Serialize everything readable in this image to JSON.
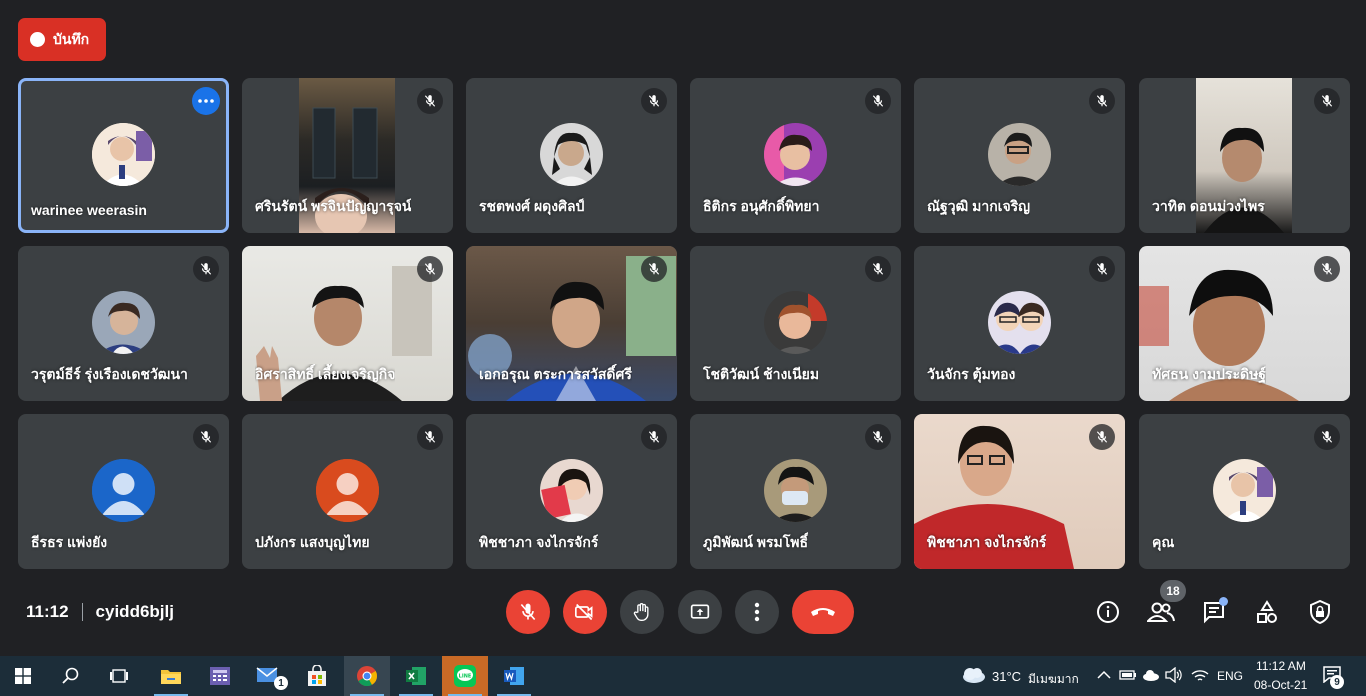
{
  "recording": {
    "label": "บันทึก"
  },
  "meeting": {
    "time": "11:12",
    "code": "cyidd6bjlj",
    "participant_count": "18"
  },
  "participants": [
    {
      "name": "warinee weerasin",
      "mic": "on",
      "active": true
    },
    {
      "name": "ศรินรัตน์ พรจินปัญญารุจน์",
      "mic": "muted"
    },
    {
      "name": "รชตพงศ์ ผดุงศิลป์",
      "mic": "muted"
    },
    {
      "name": "ธิติกร อนุศักดิ์พิทยา",
      "mic": "muted"
    },
    {
      "name": "ณัฐวุฒิ มากเจริญ",
      "mic": "muted"
    },
    {
      "name": "วาทิต ดอนม่วงไพร",
      "mic": "muted"
    },
    {
      "name": "วรุตม์ธีร์ รุ่งเรืองเดชวัฒนา",
      "mic": "muted"
    },
    {
      "name": "อิศราสิทธิ์ เลี้ยงเจริญกิจ",
      "mic": "muted"
    },
    {
      "name": "เอกอรุณ ตระการสวัสดิ์ศรี",
      "mic": "muted"
    },
    {
      "name": "โชติวัฒน์ ช้างเนียม",
      "mic": "muted"
    },
    {
      "name": "วันจักร ตุ้มทอง",
      "mic": "muted"
    },
    {
      "name": "ทัศธน งามประดิษฐ์",
      "mic": "muted"
    },
    {
      "name": "ธีรธร แพ่งยัง",
      "mic": "muted"
    },
    {
      "name": "ปภังกร แสงบุญไทย",
      "mic": "muted"
    },
    {
      "name": "พิชชาภา จงไกรจักร์",
      "mic": "muted"
    },
    {
      "name": "ภูมิพัฒน์ พรมโพธิ์",
      "mic": "muted"
    },
    {
      "name": "พิชชาภา จงไกรจักร์",
      "mic": "muted"
    },
    {
      "name": "คุณ",
      "mic": "muted"
    }
  ],
  "controls": {
    "mic": "mic-off-icon",
    "camera": "camera-off-icon",
    "hand": "raise-hand-icon",
    "present": "present-screen-icon",
    "more": "more-options-icon",
    "leave": "leave-call-icon"
  },
  "colors": {
    "accent": "#8ab4f8",
    "danger": "#ea4335",
    "tile": "#3c4043",
    "background": "#202124",
    "recording": "#d93025"
  },
  "taskbar": {
    "weather_temp": "31°C",
    "weather_desc": "มีเมฆมาก",
    "language": "ENG",
    "clock_time": "11:12 AM",
    "clock_date": "08-Oct-21",
    "mail_badge": "1",
    "notification_count": "9"
  }
}
